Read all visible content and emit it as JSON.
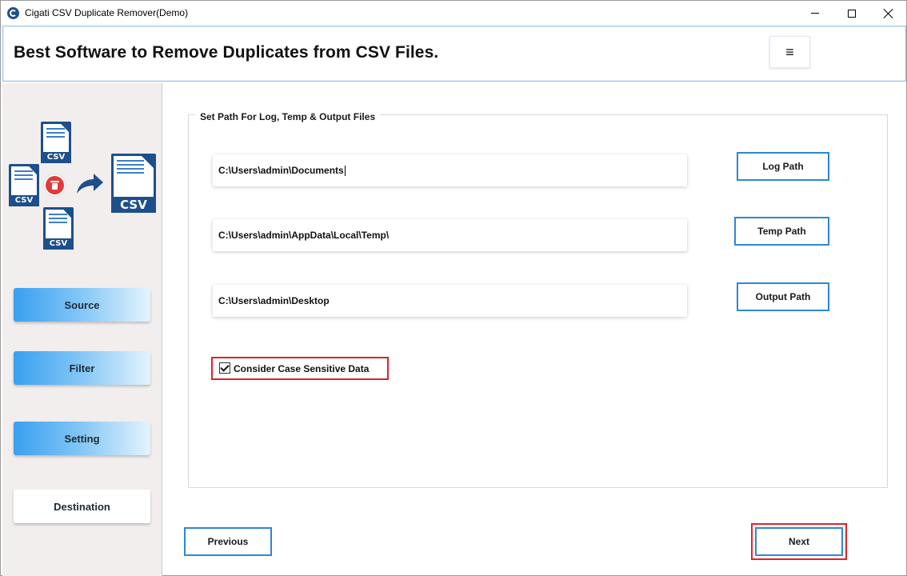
{
  "window": {
    "title": "Cigati CSV Duplicate Remover(Demo)"
  },
  "header": {
    "title": "Best Software to Remove Duplicates from CSV Files.",
    "menu_icon": "hamburger-icon"
  },
  "sidebar": {
    "illustration": {
      "doc_label": "CSV",
      "icons": [
        "csv-file-icon",
        "trash-icon",
        "arrow-icon"
      ]
    },
    "items": [
      {
        "label": "Source",
        "state": "active"
      },
      {
        "label": "Filter",
        "state": "active"
      },
      {
        "label": "Setting",
        "state": "active"
      },
      {
        "label": "Destination",
        "state": "inactive"
      }
    ]
  },
  "main": {
    "group_title": "Set Path For Log, Temp & Output Files",
    "paths": [
      {
        "value": "C:\\Users\\admin\\Documents",
        "button": "Log Path"
      },
      {
        "value": "C:\\Users\\admin\\AppData\\Local\\Temp\\",
        "button": "Temp Path"
      },
      {
        "value": "C:\\Users\\admin\\Desktop",
        "button": "Output Path"
      }
    ],
    "case_sensitive": {
      "label": "Consider Case Sensitive Data",
      "checked": true
    }
  },
  "footer": {
    "previous_label": "Previous",
    "next_label": "Next"
  },
  "colors": {
    "accent_blue": "#2e86d6",
    "highlight_red": "#e0222a",
    "sidebar_bg": "#f3eeee",
    "brand_navy": "#1d4f8c"
  }
}
